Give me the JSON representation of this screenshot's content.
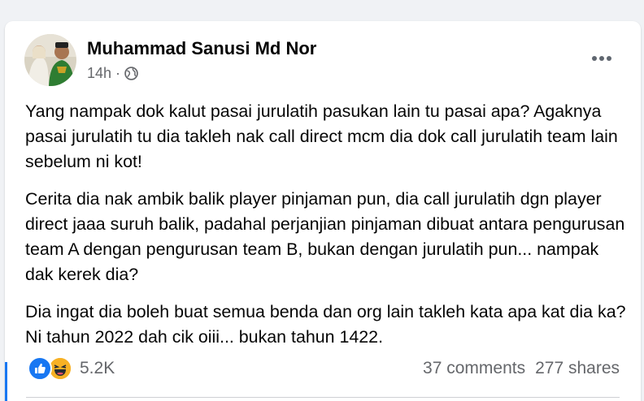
{
  "post": {
    "author": "Muhammad Sanusi Md Nor",
    "time": "14h",
    "separator": "·",
    "paragraphs": [
      "Yang nampak dok kalut pasai jurulatih pasukan lain tu pasai apa? Agaknya pasai jurulatih tu dia takleh nak call direct mcm dia dok call jurulatih team lain sebelum ni kot!",
      "Cerita dia nak ambik balik player pinjaman pun, dia call jurulatih dgn player direct jaaa suruh balik, padahal perjanjian pinjaman dibuat antara pengurusan team A dengan pengurusan team B, bukan dengan jurulatih pun... nampak dak kerek dia?",
      "Dia ingat dia boleh buat semua benda dan org lain takleh kata apa kat dia ka? Ni tahun 2022 dah cik oiii... bukan tahun 1422."
    ],
    "reactions": {
      "icons": [
        "like-icon",
        "haha-icon"
      ],
      "count": "5.2K"
    },
    "comments": "37 comments",
    "shares": "277 shares"
  },
  "colors": {
    "like": "#1877f2",
    "haha": "#f7b125",
    "secondary_text": "#65676b",
    "primary_text": "#050505"
  }
}
